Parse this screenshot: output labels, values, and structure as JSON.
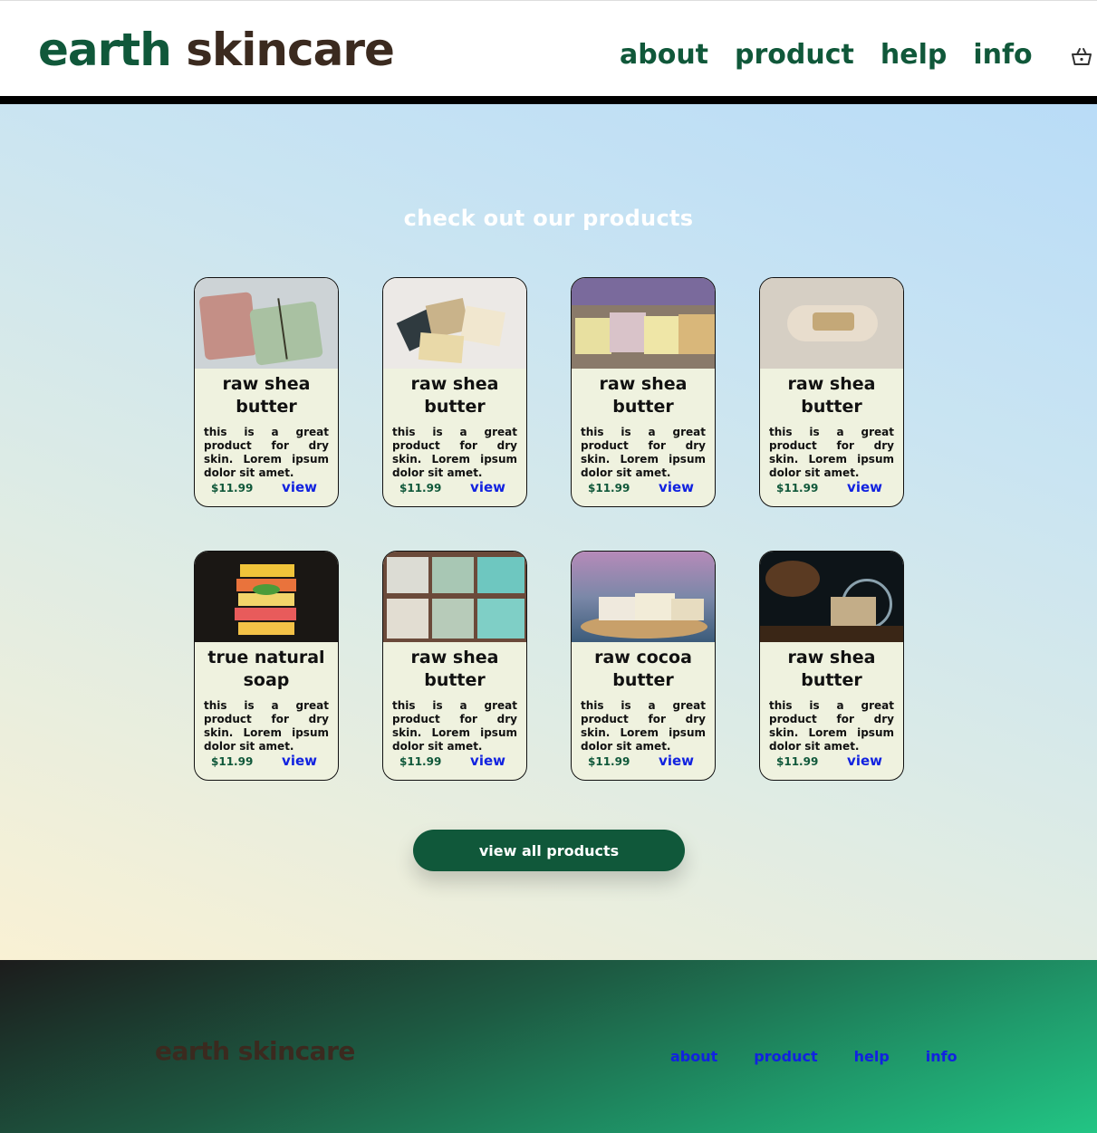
{
  "header": {
    "logo_part1": "earth",
    "logo_part2": "skincare",
    "nav": [
      "about",
      "product",
      "help",
      "info"
    ]
  },
  "main": {
    "section_title": "check out our products",
    "products": [
      {
        "name": "raw shea butter",
        "desc": "this is a great product for dry skin. Lorem ipsum dolor sit amet.",
        "price": "$11.99",
        "link": "view"
      },
      {
        "name": "raw shea butter",
        "desc": "this is a great product for dry skin. Lorem ipsum dolor sit amet.",
        "price": "$11.99",
        "link": "view"
      },
      {
        "name": "raw shea butter",
        "desc": "this is a great product for dry skin. Lorem ipsum dolor sit amet.",
        "price": "$11.99",
        "link": "view"
      },
      {
        "name": "raw shea butter",
        "desc": "this is a great product for dry skin. Lorem ipsum dolor sit amet.",
        "price": "$11.99",
        "link": "view"
      },
      {
        "name": "true natural soap",
        "desc": "this is a great product for dry skin. Lorem ipsum dolor sit amet.",
        "price": "$11.99",
        "link": "view"
      },
      {
        "name": "raw shea butter",
        "desc": "this is a great product for dry skin. Lorem ipsum dolor sit amet.",
        "price": "$11.99",
        "link": "view"
      },
      {
        "name": "raw cocoa butter",
        "desc": "this is a great product for dry skin. Lorem ipsum dolor sit amet.",
        "price": "$11.99",
        "link": "view"
      },
      {
        "name": "raw shea butter",
        "desc": "this is a great product for dry skin. Lorem ipsum dolor sit amet.",
        "price": "$11.99",
        "link": "view"
      }
    ],
    "view_all_label": "view all products"
  },
  "footer": {
    "logo": "earth skincare",
    "nav": [
      "about",
      "product",
      "help",
      "info"
    ]
  },
  "colors": {
    "brand_green": "#10583a",
    "brand_brown": "#3b2a1f",
    "link_blue": "#1122e0",
    "card_bg": "#eff2df"
  }
}
